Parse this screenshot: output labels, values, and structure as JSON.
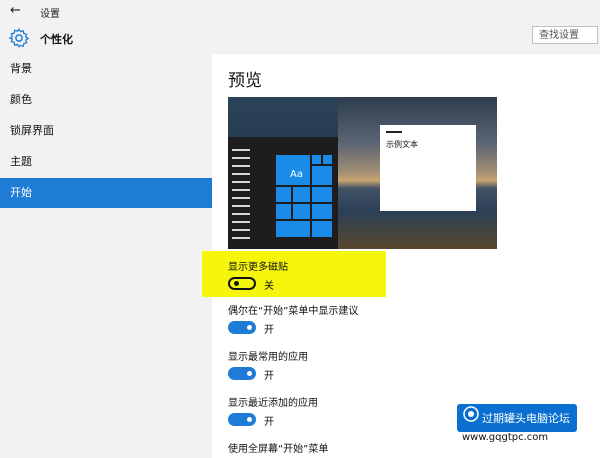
{
  "window": {
    "title": "设置"
  },
  "header": {
    "title": "个性化",
    "search_placeholder": "查找设置"
  },
  "sidebar": {
    "items": [
      "背景",
      "颜色",
      "锁屏界面",
      "主题",
      "开始"
    ],
    "selected": "开始"
  },
  "main": {
    "title": "预览",
    "preview_text": "示例文本",
    "preview_tile_label": "Aa",
    "settings": [
      {
        "label": "显示更多磁贴",
        "state": "关",
        "on": false
      },
      {
        "label": "偶尔在“开始”菜单中显示建议",
        "state": "开",
        "on": true
      },
      {
        "label": "显示最常用的应用",
        "state": "开",
        "on": true
      },
      {
        "label": "显示最近添加的应用",
        "state": "开",
        "on": true
      },
      {
        "label": "使用全屏幕“开始”菜单",
        "state": "",
        "on": null
      }
    ]
  },
  "watermark": {
    "text": "过期罐头电脑论坛",
    "url": "www.gqgtpc.com"
  },
  "colors": {
    "accent": "#1e7cd6",
    "highlight": "#f6f60c",
    "sidebar_bg": "#f2f2f2"
  }
}
